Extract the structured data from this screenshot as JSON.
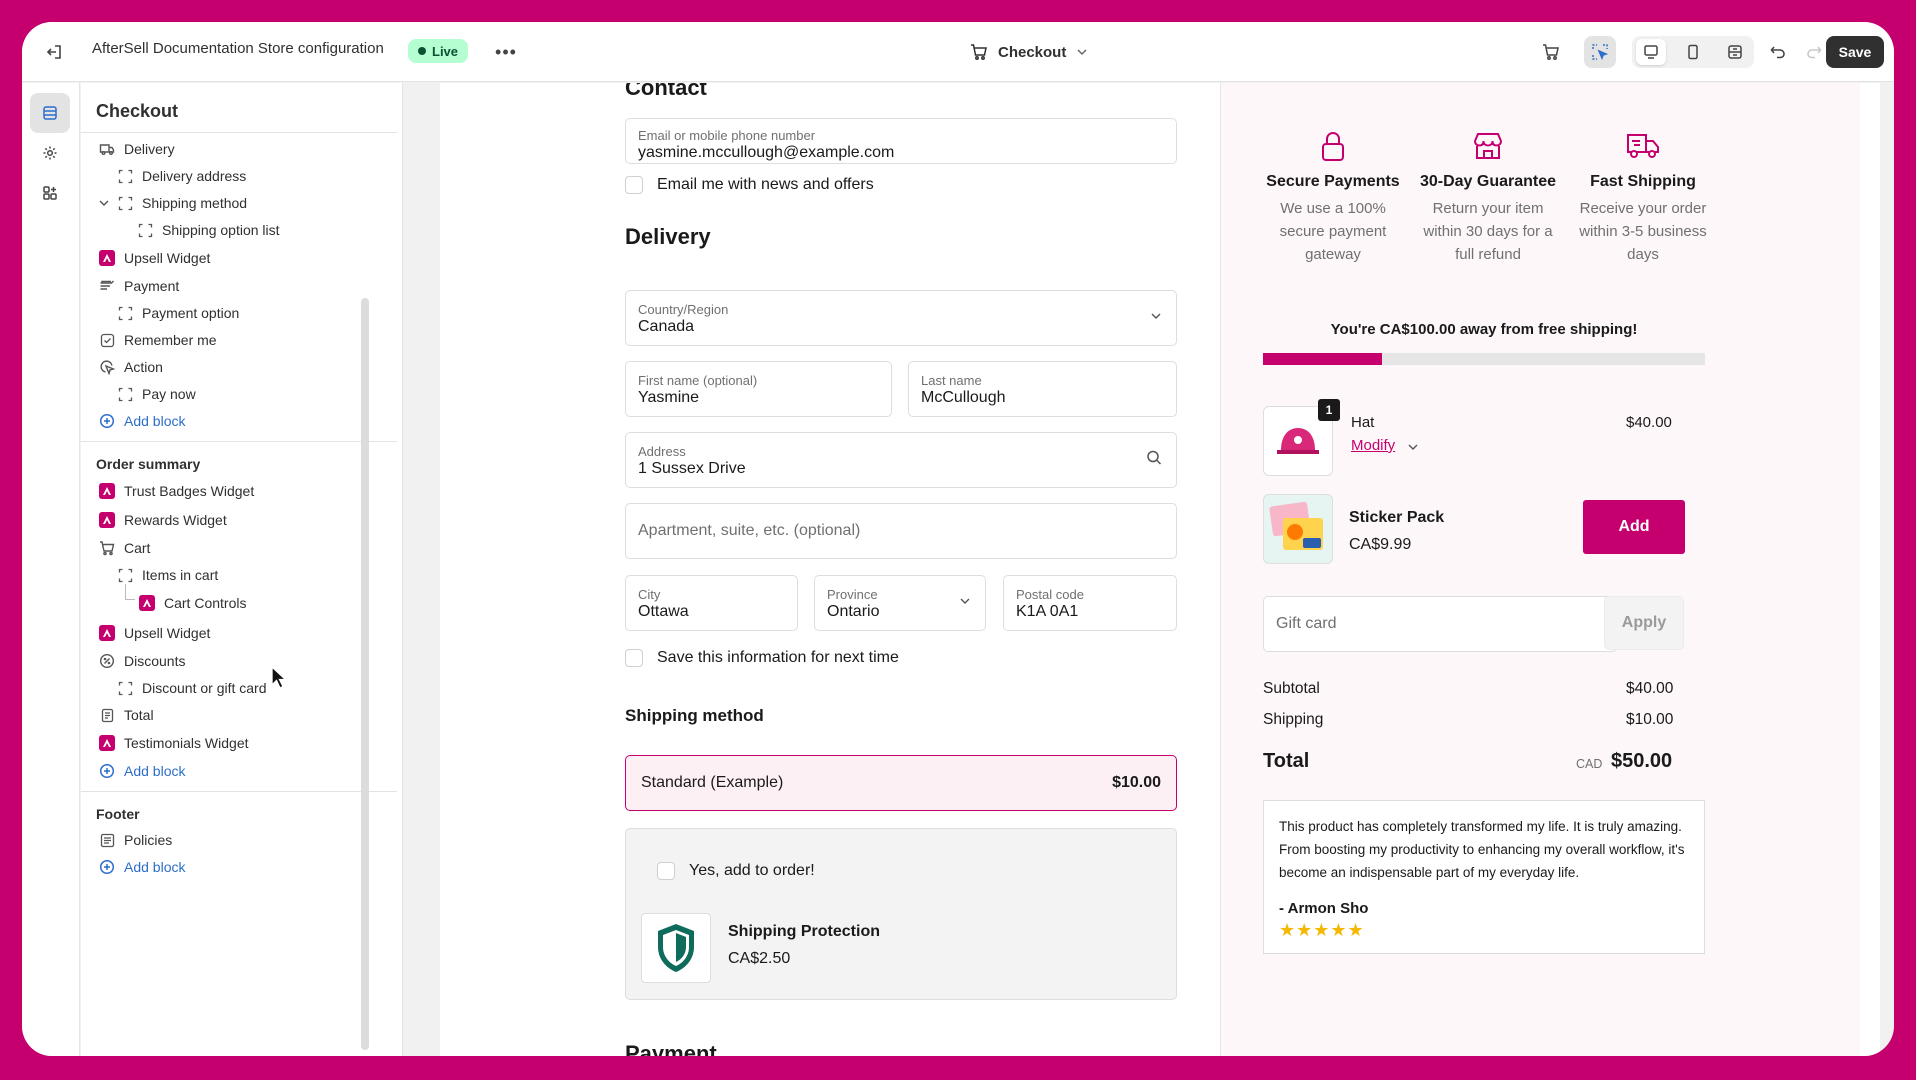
{
  "topbar": {
    "store_title": "AfterSell Documentation Store configuration",
    "live_badge": "Live",
    "page_selector": "Checkout",
    "save_label": "Save"
  },
  "sidebar": {
    "title": "Checkout",
    "checkout_items": [
      {
        "label": "Delivery",
        "icon": "truck-icon"
      },
      {
        "label": "Delivery address",
        "icon": "block-icon"
      },
      {
        "label": "Shipping method",
        "icon": "block-icon"
      },
      {
        "label": "Shipping option list",
        "icon": "block-icon"
      },
      {
        "label": "Upsell Widget",
        "icon": "app-icon"
      },
      {
        "label": "Payment",
        "icon": "cash-icon"
      },
      {
        "label": "Payment option",
        "icon": "block-icon"
      },
      {
        "label": "Remember me",
        "icon": "checkbox-icon"
      },
      {
        "label": "Action",
        "icon": "cursor-click-icon"
      },
      {
        "label": "Pay now",
        "icon": "block-icon"
      }
    ],
    "add_block": "Add block",
    "order_summary": {
      "title": "Order summary",
      "items": [
        {
          "label": "Trust Badges Widget",
          "icon": "app-icon"
        },
        {
          "label": "Rewards Widget",
          "icon": "app-icon"
        },
        {
          "label": "Cart",
          "icon": "cart-icon"
        },
        {
          "label": "Items in cart",
          "icon": "block-icon"
        },
        {
          "label": "Cart Controls",
          "icon": "app-icon"
        },
        {
          "label": "Upsell Widget",
          "icon": "app-icon"
        },
        {
          "label": "Discounts",
          "icon": "discount-icon"
        },
        {
          "label": "Discount or gift card",
          "icon": "block-icon"
        },
        {
          "label": "Total",
          "icon": "receipt-icon"
        },
        {
          "label": "Testimonials Widget",
          "icon": "app-icon"
        }
      ]
    },
    "footer": {
      "title": "Footer",
      "items": [
        {
          "label": "Policies",
          "icon": "policy-icon"
        }
      ]
    }
  },
  "checkout": {
    "contact_heading": "Contact",
    "email_label": "Email or mobile phone number",
    "email_value": "yasmine.mccullough@example.com",
    "news_label": "Email me with news and offers",
    "delivery_heading": "Delivery",
    "country_label": "Country/Region",
    "country_value": "Canada",
    "first_name_label": "First name (optional)",
    "first_name_value": "Yasmine",
    "last_name_label": "Last name",
    "last_name_value": "McCullough",
    "address_label": "Address",
    "address_value": "1 Sussex Drive",
    "apartment_placeholder": "Apartment, suite, etc. (optional)",
    "city_label": "City",
    "city_value": "Ottawa",
    "province_label": "Province",
    "province_value": "Ontario",
    "postal_label": "Postal code",
    "postal_value": "K1A 0A1",
    "save_info_label": "Save this information for next time",
    "shipping_method_heading": "Shipping method",
    "shipping_option_name": "Standard (Example)",
    "shipping_option_price": "$10.00",
    "protection_checkbox": "Yes, add to order!",
    "protection_title": "Shipping Protection",
    "protection_price": "CA$2.50",
    "payment_heading": "Payment"
  },
  "summary": {
    "badges": [
      {
        "title": "Secure Payments",
        "desc": "We use a 100% secure payment gateway",
        "icon": "lock-icon"
      },
      {
        "title": "30-Day Guarantee",
        "desc": "Return your item within 30 days for a full refund",
        "icon": "store-icon"
      },
      {
        "title": "Fast Shipping",
        "desc": "Receive your order within 3-5 business days",
        "icon": "delivery-truck-icon"
      }
    ],
    "free_shipping_message": "You're CA$100.00 away from free shipping!",
    "free_shipping_progress": 0.27,
    "cart_item": {
      "name": "Hat",
      "quantity": "1",
      "modify": "Modify",
      "price": "$40.00"
    },
    "upsell": {
      "name": "Sticker Pack",
      "price": "CA$9.99",
      "button": "Add"
    },
    "gift_card_placeholder": "Gift card",
    "apply_label": "Apply",
    "subtotal_label": "Subtotal",
    "subtotal_value": "$40.00",
    "shipping_label": "Shipping",
    "shipping_value": "$10.00",
    "total_label": "Total",
    "currency": "CAD",
    "total_value": "$50.00",
    "testimonial": {
      "quote": "This product has completely transformed my life. It is truly amazing. From boosting my productivity to enhancing my overall workflow, it's become an indispensable part of my everyday life.",
      "author": "- Armon Sho",
      "stars": "★★★★★"
    }
  },
  "colors": {
    "brand": "#c5006e",
    "accent_blue": "#2c6ecb",
    "live_green": "#b4fed2"
  }
}
